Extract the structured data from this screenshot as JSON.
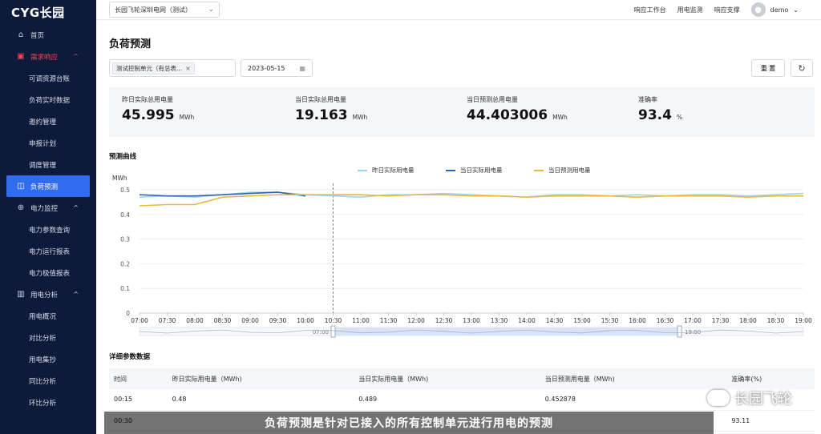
{
  "app": {
    "logo": "CYG长园"
  },
  "sidebar": {
    "items": [
      {
        "label": "首页",
        "icon": "home-icon",
        "type": "top"
      },
      {
        "label": "需求响应",
        "icon": "demand-response-icon",
        "type": "group-open"
      },
      {
        "label": "可调资源台账",
        "type": "sub"
      },
      {
        "label": "负荷实时数据",
        "type": "sub"
      },
      {
        "label": "邀约管理",
        "type": "sub"
      },
      {
        "label": "申报计划",
        "type": "sub"
      },
      {
        "label": "调度管理",
        "type": "sub"
      },
      {
        "label": "负荷预测",
        "icon": "forecast-icon",
        "type": "active"
      },
      {
        "label": "电力监控",
        "icon": "power-monitor-icon",
        "type": "group"
      },
      {
        "label": "电力参数查询",
        "type": "sub"
      },
      {
        "label": "电力运行报表",
        "type": "sub"
      },
      {
        "label": "电力极值报表",
        "type": "sub"
      },
      {
        "label": "用电分析",
        "icon": "usage-analysis-icon",
        "type": "group"
      },
      {
        "label": "用电概况",
        "type": "sub"
      },
      {
        "label": "对比分析",
        "type": "sub"
      },
      {
        "label": "用电集抄",
        "type": "sub"
      },
      {
        "label": "同比分析",
        "type": "sub"
      },
      {
        "label": "环比分析",
        "type": "sub"
      }
    ]
  },
  "header": {
    "grid_select": "长园飞轮深圳电网（测试）",
    "links": [
      "响应工作台",
      "用电监测",
      "响应支撑"
    ],
    "user": "demo"
  },
  "page": {
    "title": "负荷预测",
    "filter_tag": "测试控制单元（有总表...",
    "date": "2023-05-15",
    "reset_label": "重 置"
  },
  "stats": [
    {
      "label": "昨日实际总用电量",
      "value": "45.995",
      "unit": "MWh"
    },
    {
      "label": "当日实际总用电量",
      "value": "19.163",
      "unit": "MWh"
    },
    {
      "label": "当日预测总用电量",
      "value": "44.403006",
      "unit": "MWh"
    },
    {
      "label": "准确率",
      "value": "93.4",
      "unit": "%"
    }
  ],
  "chart_section_title": "预测曲线",
  "chart_data": {
    "type": "line",
    "ylabel": "MWh",
    "ylim": [
      0,
      0.5
    ],
    "yticks": [
      0,
      0.1,
      0.2,
      0.3,
      0.4,
      0.5
    ],
    "x": [
      "07:00",
      "07:30",
      "08:00",
      "08:30",
      "09:00",
      "09:30",
      "10:00",
      "10:30",
      "11:00",
      "11:30",
      "12:00",
      "12:30",
      "13:00",
      "13:30",
      "14:00",
      "14:30",
      "15:00",
      "15:30",
      "16:00",
      "16:30",
      "17:00",
      "17:30",
      "18:00",
      "18:30",
      "19:00"
    ],
    "series": [
      {
        "name": "昨日实际用电量",
        "color": "#9fd3ee",
        "values": [
          0.47,
          0.475,
          0.47,
          0.48,
          0.49,
          0.49,
          0.48,
          0.475,
          0.47,
          0.48,
          0.48,
          0.485,
          0.48,
          0.475,
          0.47,
          0.48,
          0.48,
          0.475,
          0.48,
          0.475,
          0.48,
          0.48,
          0.475,
          0.48,
          0.485
        ]
      },
      {
        "name": "当日实际用电量",
        "color": "#2f64b8",
        "values": [
          0.48,
          0.475,
          0.475,
          0.48,
          0.485,
          0.49,
          0.475,
          null,
          null,
          null,
          null,
          null,
          null,
          null,
          null,
          null,
          null,
          null,
          null,
          null,
          null,
          null,
          null,
          null,
          null
        ]
      },
      {
        "name": "当日预测用电量",
        "color": "#e8b93a",
        "values": [
          0.435,
          0.44,
          0.44,
          0.47,
          0.475,
          0.48,
          0.48,
          0.48,
          0.48,
          0.475,
          0.48,
          0.48,
          0.475,
          0.475,
          0.47,
          0.475,
          0.475,
          0.475,
          0.47,
          0.475,
          0.475,
          0.475,
          0.47,
          0.475,
          0.475
        ]
      }
    ],
    "slider_range": [
      "07:00",
      "19:00"
    ],
    "cursor_x": "10:30",
    "grid": "horizontal",
    "legend": "top-center"
  },
  "table_section_title": "详细参数数据",
  "table": {
    "headers": [
      "时间",
      "昨日实际用电量（MWh)",
      "当日实际用电量（MWh)",
      "当日预测用电量（MWh)",
      "准确率(%)"
    ],
    "rows": [
      [
        "00:15",
        "0.48",
        "0.489",
        "0.452878",
        ""
      ],
      [
        "00:30",
        "",
        "",
        "",
        "93.11"
      ]
    ]
  },
  "overlay": {
    "subtitle": "负荷预测是针对已接入的所有控制单元进行用电的预测",
    "watermark": "长园飞轮"
  }
}
